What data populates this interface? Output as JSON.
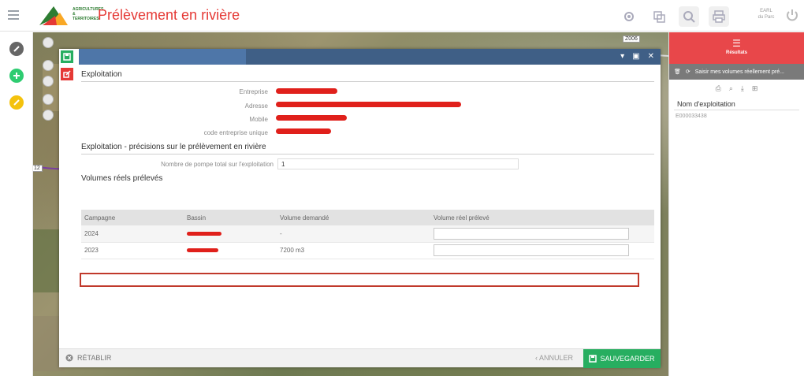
{
  "header": {
    "logo_text": "AGRICULTURES & TERRITOIRES",
    "title": "Prélèvement en rivière",
    "user_line1": "EARL",
    "user_line2": "du Parc"
  },
  "map": {
    "road_label_top": "Z006",
    "road_label_left": "12"
  },
  "dialog": {
    "section1_title": "Exploitation",
    "fields": {
      "entreprise_label": "Entreprise",
      "adresse_label": "Adresse",
      "mobile_label": "Mobile",
      "code_label": "code entreprise unique"
    },
    "section2_title": "Exploitation - précisions sur le prélèvement en rivière",
    "pumps_label": "Nombre de pompe total sur l'exploitation",
    "pumps_value": "1",
    "section3_title": "Volumes réels prélevés",
    "table": {
      "headers": [
        "Campagne",
        "Bassin",
        "Volume demandé",
        "Volume réel prélevé"
      ],
      "rows": [
        {
          "campagne": "2024",
          "volume_demande": "-",
          "volume_reel": ""
        },
        {
          "campagne": "2023",
          "volume_demande": "7200 m3",
          "volume_reel": ""
        }
      ]
    },
    "footer": {
      "reset_label": "RÉTABLIR",
      "cancel_label": "ANNULER",
      "save_label": "SAUVEGARDER"
    }
  },
  "right_panel": {
    "header_label": "Résultats",
    "toolbar_text": "Saisir mes volumes réellement pré...",
    "column_header": "Nom d'exploitation",
    "rows": [
      "E000033438"
    ]
  },
  "colors": {
    "accent_red": "#e53935",
    "dialog_header": "#3f5f86",
    "save_green": "#27ae60",
    "highlight_border": "#c0392b"
  }
}
